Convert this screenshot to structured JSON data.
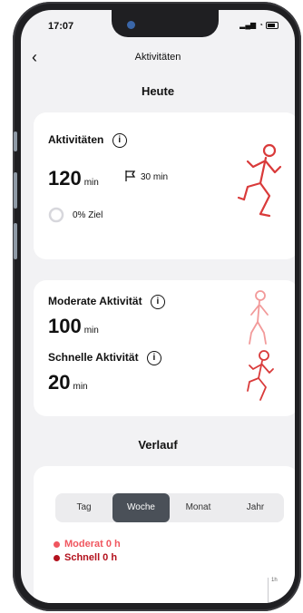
{
  "status": {
    "time": "17:07"
  },
  "nav": {
    "title": "Aktivitäten"
  },
  "today_title": "Heute",
  "activity_card": {
    "title": "Aktivitäten",
    "value": "120",
    "unit": "min",
    "goal_value": "30 min",
    "progress_label": "0% Ziel",
    "progress_fraction": 0
  },
  "intensity_card": {
    "moderate": {
      "title": "Moderate Aktivität",
      "value": "100",
      "unit": "min"
    },
    "vigorous": {
      "title": "Schnelle Aktivität",
      "value": "20",
      "unit": "min"
    }
  },
  "history": {
    "title": "Verlauf",
    "tabs": [
      "Tag",
      "Woche",
      "Monat",
      "Jahr"
    ],
    "active_tab": "Woche",
    "legend": [
      {
        "label": "Moderat 0 h",
        "color": "#f0565f"
      },
      {
        "label": "Schnell 0 h",
        "color": "#b3111d"
      }
    ],
    "axis_label": "1h"
  },
  "colors": {
    "accent": "#d93a3a",
    "light_accent": "#f29a9a"
  }
}
